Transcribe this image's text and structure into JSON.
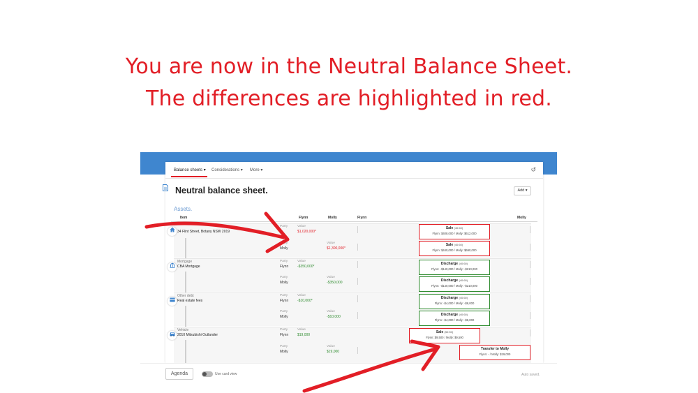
{
  "headline": {
    "line1": "You are now in the Neutral Balance Sheet.",
    "line2": "The differences are highlighted in red."
  },
  "colors": {
    "accent": "#e21e26",
    "topbar": "#3f86cf",
    "green": "#2e8b2e"
  },
  "nav": {
    "balance_sheets": "Balance sheets ▾",
    "considerations": "Considerations ▾",
    "more": "More ▾",
    "undo_icon": "↺"
  },
  "page": {
    "title": "Neutral balance sheet.",
    "add_button": "Add ▾",
    "section_label": "Assets."
  },
  "columns": {
    "item": "Item",
    "flynn": "Flynn",
    "molly": "Molly",
    "flynn2": "Flynn",
    "molly2": "Molly"
  },
  "labels": {
    "party": "Party",
    "value": "Value"
  },
  "rows": {
    "property": {
      "icon": "home-icon",
      "name": "34 Flint Street, Botany NSW 2019",
      "line1": {
        "party": "Flynn",
        "value": "$1,020,000*"
      },
      "line2": {
        "party": "Molly",
        "value": "$1,300,000*"
      },
      "box1": {
        "title": "Sale",
        "ratio": "(40:60)",
        "detail": "Flynn: $408,000 / Molly: $612,000"
      },
      "box2": {
        "title": "Sale",
        "ratio": "(40:60)",
        "detail": "Flynn: $440,000 / Molly: $660,000"
      }
    },
    "mortgage": {
      "icon": "bank-icon",
      "category": "Mortgage",
      "name": "CBA Mortgage",
      "line1": {
        "party": "Flynn",
        "value": "-$350,000*"
      },
      "line2": {
        "party": "Molly",
        "value": "-$350,000"
      },
      "box1": {
        "title": "Discharge",
        "ratio": "(40:60)",
        "detail": "Flynn: -$140,000 / Molly: -$210,000"
      },
      "box2": {
        "title": "Discharge",
        "ratio": "(40:60)",
        "detail": "Flynn: -$140,000 / Molly: -$210,000"
      }
    },
    "other_debt": {
      "icon": "credit-card-icon",
      "category": "Other debt",
      "name": "Real estate fees",
      "line1": {
        "party": "Flynn",
        "value": "-$10,000*"
      },
      "line2": {
        "party": "Molly",
        "value": "-$10,000"
      },
      "box1": {
        "title": "Discharge",
        "ratio": "(40:60)",
        "detail": "Flynn: -$4,000 / Molly: -$6,000"
      },
      "box2": {
        "title": "Discharge",
        "ratio": "(40:60)",
        "detail": "Flynn: -$4,000 / Molly: -$6,000"
      }
    },
    "vehicle": {
      "icon": "car-icon",
      "category": "Vehicle",
      "name": "2010 Mitsubishi Outlander",
      "line1": {
        "party": "Flynn",
        "value": "$19,000"
      },
      "line2": {
        "party": "Molly",
        "value": "$19,000"
      },
      "box1": {
        "title": "Sale",
        "ratio": "(50:50)",
        "detail": "Flynn: $9,500 / Molly: $9,500"
      },
      "box2": {
        "title": "Transfer to Molly",
        "ratio": "",
        "detail": "Flynn: - / Molly: $19,000"
      }
    }
  },
  "footer": {
    "agenda": "Agenda",
    "card_view": "Use card view",
    "autosaved": "Auto saved."
  }
}
